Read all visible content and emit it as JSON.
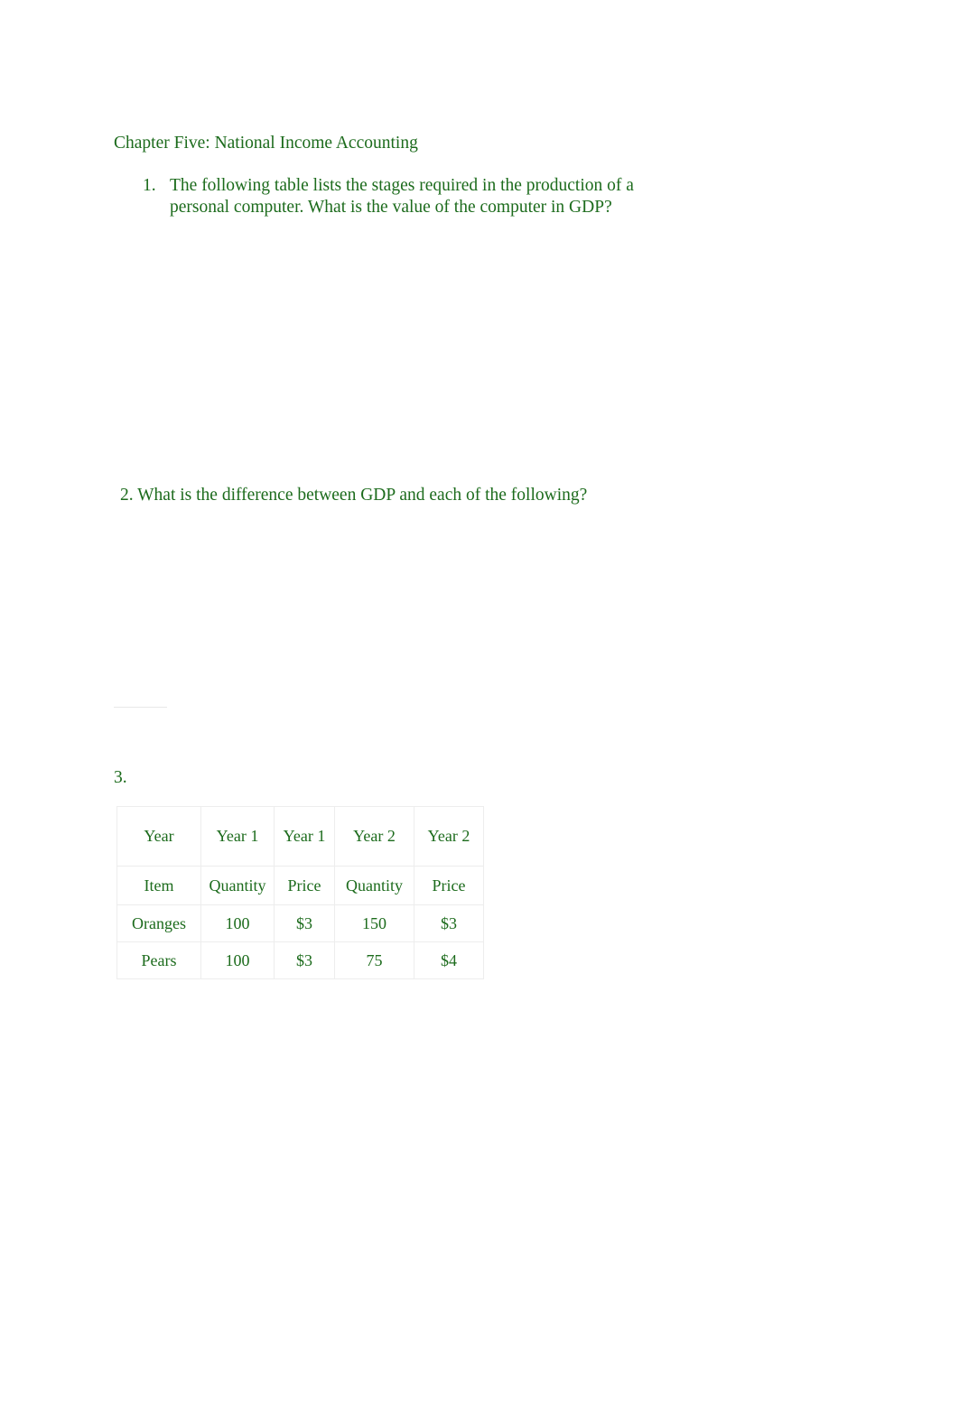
{
  "document": {
    "heading": "Chapter Five: National Income Accounting",
    "text_color": "#1c6b1c",
    "background": "#ffffff",
    "divider_color": "#e8e8e8"
  },
  "questions": [
    {
      "marker": "1.",
      "text": "The following table lists the stages required in the production of a personal computer. What is the value of the computer in GDP?"
    },
    {
      "marker": "2.",
      "text": "2. What is the difference between GDP and each of the following?"
    },
    {
      "marker": "3.",
      "text": "3."
    }
  ],
  "table": {
    "rows": [
      {
        "name": "header-year-row",
        "cells": [
          "Year",
          "Year 1",
          "Year 1",
          "Year 2",
          "Year 2"
        ]
      },
      {
        "name": "header-metric-row",
        "cells": [
          "Item",
          "Quantity",
          "Price",
          "Quantity",
          "Price"
        ]
      },
      {
        "name": "oranges-row",
        "cells": [
          "Oranges",
          "100",
          "$3",
          "150",
          "$3"
        ]
      },
      {
        "name": "pears-row",
        "cells": [
          "Pears",
          "100",
          "$3",
          "75",
          "$4"
        ]
      }
    ]
  }
}
